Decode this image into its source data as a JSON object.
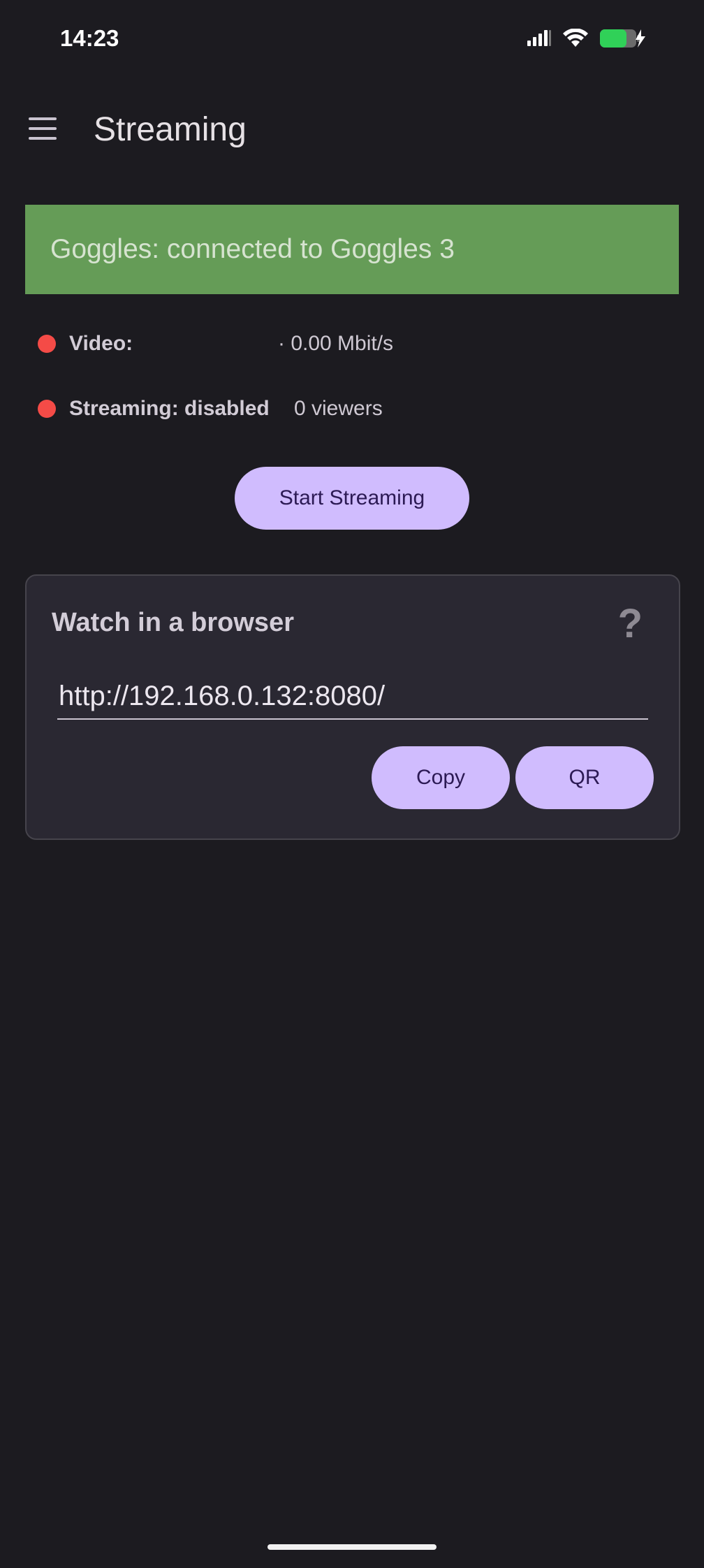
{
  "status_bar": {
    "time": "14:23",
    "icons": [
      "signal-icon",
      "wifi-icon",
      "battery-charging-icon"
    ],
    "battery_color": "#30d158"
  },
  "app_bar": {
    "title": "Streaming",
    "menu_icon": "hamburger-menu-icon"
  },
  "banner": {
    "text": "Goggles: connected to Goggles 3",
    "color": "#659c57"
  },
  "status": {
    "video": {
      "label": "Video:",
      "value": "· 0.00 Mbit/s",
      "indicator_color": "#f44b47"
    },
    "streaming": {
      "label": "Streaming: disabled",
      "value": "0 viewers",
      "indicator_color": "#f44b47"
    }
  },
  "actions": {
    "start_streaming_label": "Start Streaming"
  },
  "browser_card": {
    "title": "Watch in a browser",
    "help_icon_glyph": "?",
    "url": "http://192.168.0.132:8080/",
    "copy_label": "Copy",
    "qr_label": "QR"
  },
  "theme": {
    "background": "#1c1b20",
    "accent": "#d0bcfe",
    "on_accent": "#2c1a54"
  }
}
